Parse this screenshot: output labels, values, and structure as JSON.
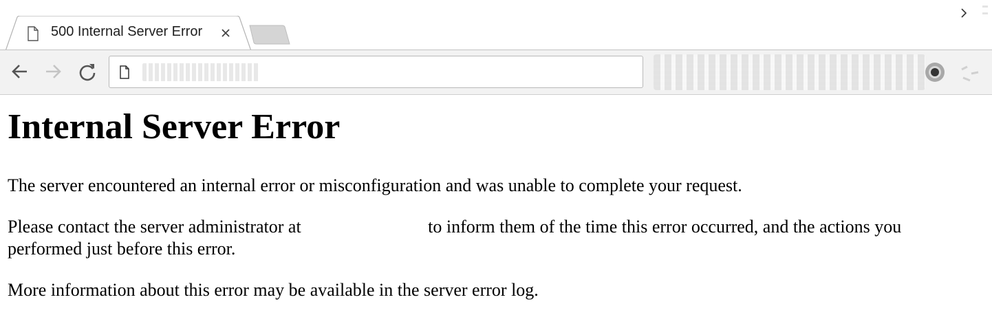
{
  "browser": {
    "tab": {
      "title": "500 Internal Server Error",
      "icon": "document-icon",
      "close_icon": "close-icon"
    },
    "new_tab_icon": "new-tab-icon",
    "toolbar": {
      "back_icon": "arrow-left-icon",
      "forward_icon": "arrow-right-icon",
      "reload_icon": "reload-icon",
      "address_icon": "document-icon",
      "address_value": ""
    },
    "colors": {
      "chrome_bg": "#f2f2f2",
      "tab_border": "#b3b3b3",
      "page_bg": "#ffffff",
      "text": "#000000"
    }
  },
  "page": {
    "heading": "Internal Server Error",
    "paragraph1": "The server encountered an internal error or misconfiguration and was unable to complete your request.",
    "paragraph2_before": "Please contact the server administrator at ",
    "paragraph2_email": "",
    "paragraph2_after": "to inform them of the time this error occurred, and the actions you performed just before this error.",
    "paragraph3": "More information about this error may be available in the server error log."
  }
}
